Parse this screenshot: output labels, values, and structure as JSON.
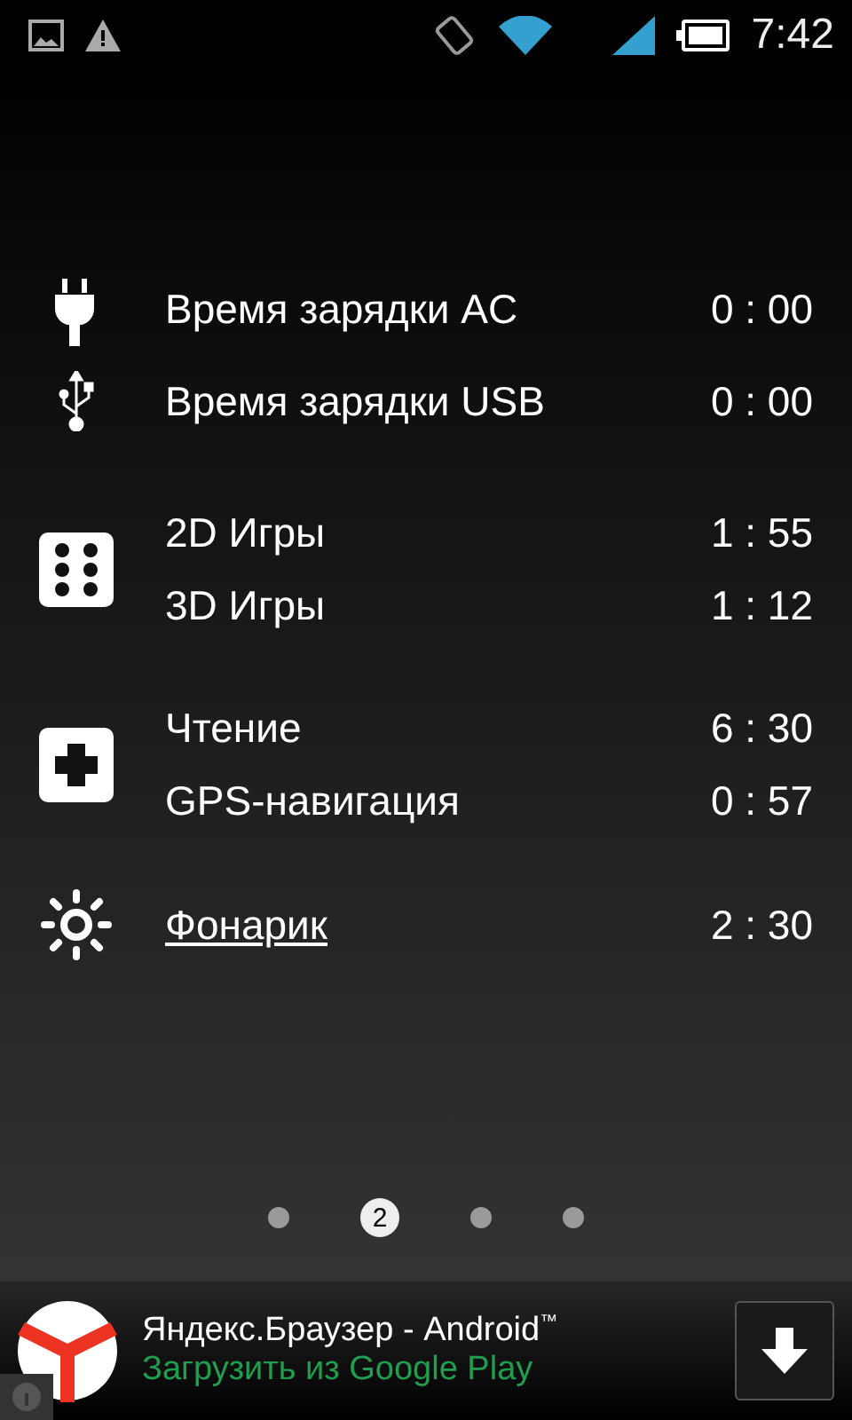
{
  "status_bar": {
    "time": "7:42"
  },
  "groups": [
    {
      "kind": "power",
      "rows": [
        {
          "label": "Время зарядки AC",
          "value": "0 : 00",
          "underlined": false
        },
        {
          "label": "Время зарядки USB",
          "value": "0 : 00",
          "underlined": false
        }
      ]
    },
    {
      "kind": "games",
      "rows": [
        {
          "label": "2D Игры",
          "value": "1 : 55",
          "underlined": false
        },
        {
          "label": "3D Игры",
          "value": "1 : 12",
          "underlined": false
        }
      ]
    },
    {
      "kind": "apps",
      "rows": [
        {
          "label": "Чтение",
          "value": "6 : 30",
          "underlined": false
        },
        {
          "label": "GPS-навигация",
          "value": "0 : 57",
          "underlined": false
        }
      ]
    },
    {
      "kind": "light",
      "rows": [
        {
          "label": "Фонарик",
          "value": "2 : 30",
          "underlined": true
        }
      ]
    }
  ],
  "pages": [
    {
      "selected": false
    },
    {
      "selected": true,
      "label": "2"
    },
    {
      "selected": false
    },
    {
      "selected": false
    }
  ],
  "ad": {
    "title": "Яндекс.Браузер - Android$^{™}$",
    "subtitle": "Загрузить из Google Play"
  }
}
